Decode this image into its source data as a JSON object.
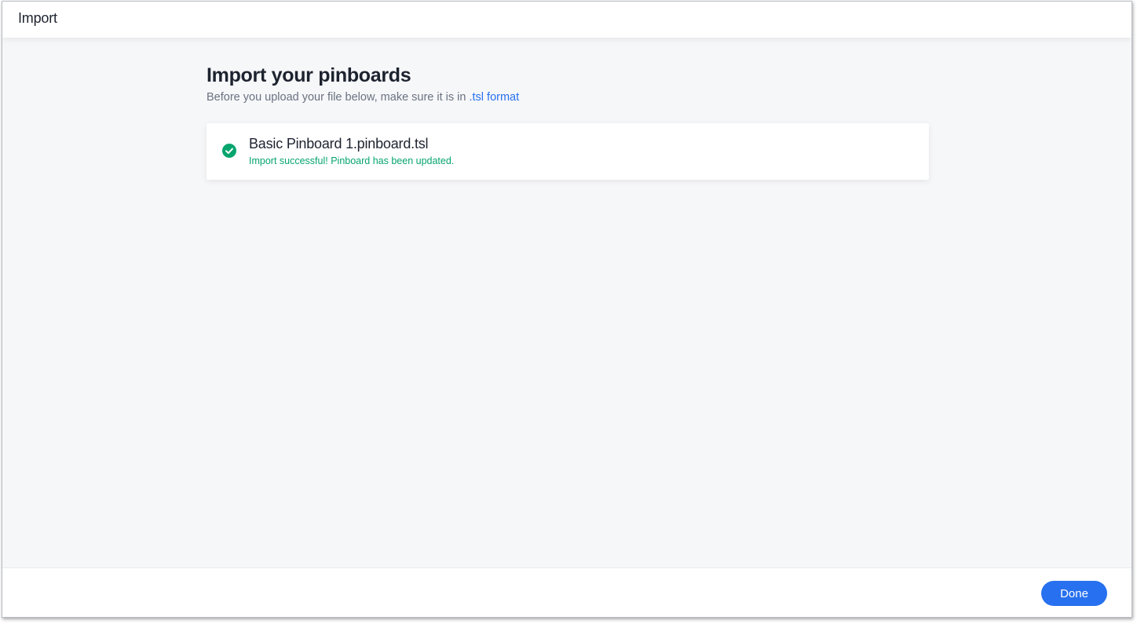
{
  "header": {
    "title": "Import"
  },
  "main": {
    "title": "Import your pinboards",
    "subtitle_prefix": "Before you upload your file below, make sure it is in ",
    "format_link": ".tsl format"
  },
  "file": {
    "name": "Basic Pinboard 1.pinboard.tsl",
    "status": "Import successful! Pinboard has been updated.",
    "status_icon": "check-circle-icon",
    "status_color": "#06a56e"
  },
  "footer": {
    "done_label": "Done"
  },
  "colors": {
    "accent": "#2770ef",
    "success": "#06a56e"
  }
}
